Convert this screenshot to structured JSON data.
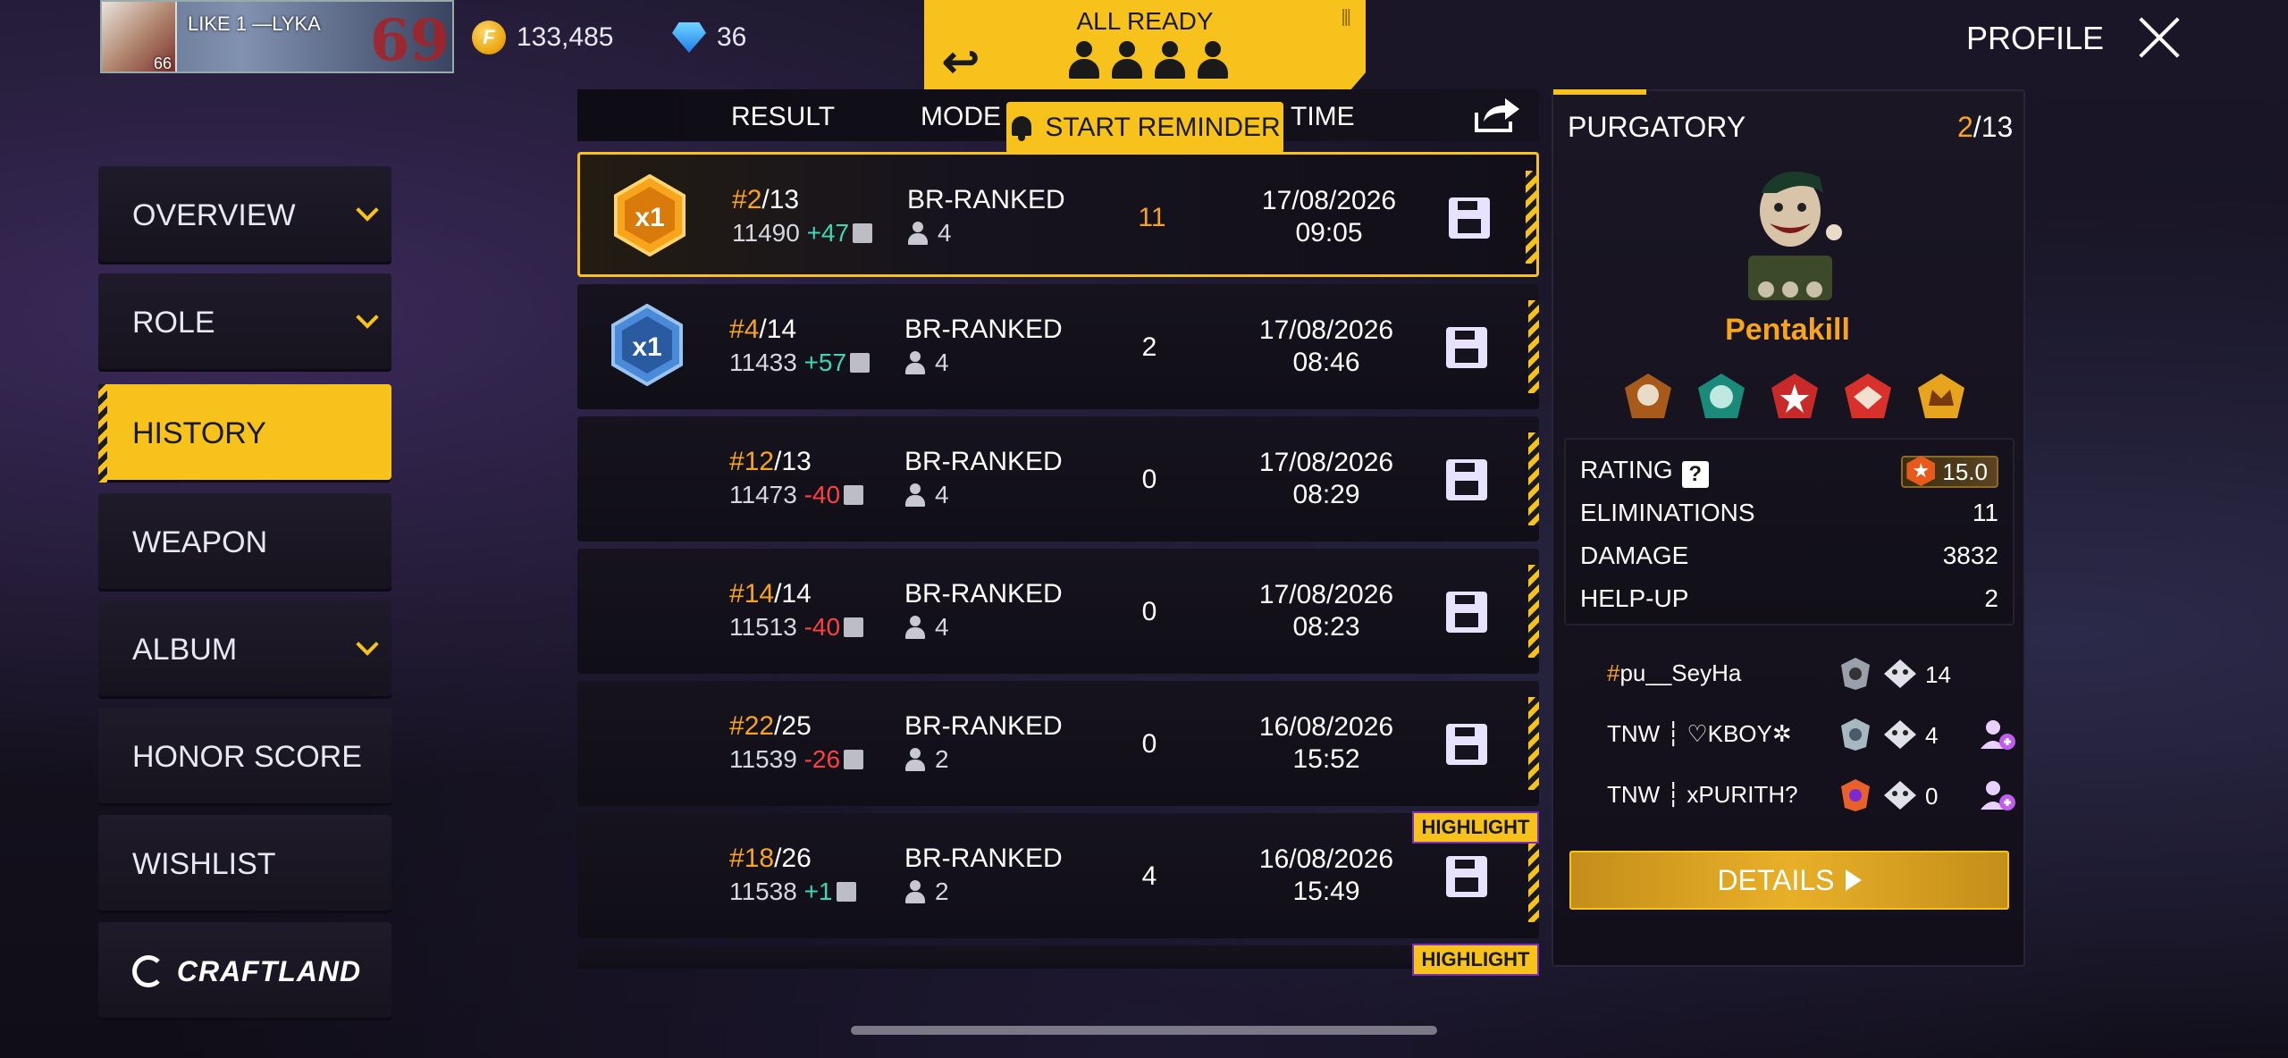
{
  "player": {
    "like_label": "LIKE",
    "like_count": "1",
    "name": "—LYKA",
    "level": "66",
    "badge_number": "69"
  },
  "currency": {
    "gold": "133,485",
    "diamonds": "36"
  },
  "lobby": {
    "status": "ALL READY",
    "reminder_label": "START REMINDER"
  },
  "header": {
    "profile_label": "PROFILE"
  },
  "sidebar": {
    "items": [
      {
        "label": "OVERVIEW",
        "expandable": true
      },
      {
        "label": "ROLE",
        "expandable": true
      },
      {
        "label": "HISTORY",
        "expandable": false,
        "active": true
      },
      {
        "label": "WEAPON",
        "expandable": false
      },
      {
        "label": "ALBUM",
        "expandable": true
      },
      {
        "label": "HONOR SCORE",
        "expandable": false
      },
      {
        "label": "WISHLIST",
        "expandable": false
      },
      {
        "label": "CRAFTLAND",
        "expandable": false
      }
    ]
  },
  "history": {
    "columns": [
      "RESULT",
      "MODE",
      "TIME"
    ],
    "rows": [
      {
        "rank": "2",
        "total": "13",
        "score": "11490",
        "delta": "+47",
        "mode": "BR-RANKED",
        "team": "4",
        "elims": "11",
        "date": "17/08/2026",
        "time": "09:05",
        "medal": "x1",
        "medal_color": "#f8a41c"
      },
      {
        "rank": "4",
        "total": "14",
        "score": "11433",
        "delta": "+57",
        "mode": "BR-RANKED",
        "team": "4",
        "elims": "2",
        "date": "17/08/2026",
        "time": "08:46",
        "medal": "x1",
        "medal_color": "#4a8ad8"
      },
      {
        "rank": "12",
        "total": "13",
        "score": "11473",
        "delta": "-40",
        "mode": "BR-RANKED",
        "team": "4",
        "elims": "0",
        "date": "17/08/2026",
        "time": "08:29"
      },
      {
        "rank": "14",
        "total": "14",
        "score": "11513",
        "delta": "-40",
        "mode": "BR-RANKED",
        "team": "4",
        "elims": "0",
        "date": "17/08/2026",
        "time": "08:23"
      },
      {
        "rank": "22",
        "total": "25",
        "score": "11539",
        "delta": "-26",
        "mode": "BR-RANKED",
        "team": "2",
        "elims": "0",
        "date": "16/08/2026",
        "time": "15:52"
      },
      {
        "rank": "18",
        "total": "26",
        "score": "11538",
        "delta": "+1",
        "mode": "BR-RANKED",
        "team": "2",
        "elims": "4",
        "date": "16/08/2026",
        "time": "15:49"
      }
    ],
    "highlight_label": "HIGHLIGHT"
  },
  "detail": {
    "map": "PURGATORY",
    "rank": "2",
    "total": "13",
    "character_title": "Pentakill",
    "stats": [
      {
        "label": "RATING",
        "value": "15.0"
      },
      {
        "label": "ELIMINATIONS",
        "value": "11"
      },
      {
        "label": "DAMAGE",
        "value": "3832"
      },
      {
        "label": "HELP-UP",
        "value": "2"
      }
    ],
    "team": [
      {
        "prefix": "#",
        "name": "pu__SeyHa",
        "kills": "14"
      },
      {
        "prefix": "TNW ┆ ",
        "name": "♡KBOY✲",
        "kills": "4"
      },
      {
        "prefix": "TNW ┆ ",
        "name": "xPURITH?",
        "kills": "0"
      }
    ],
    "details_label": "DETAILS"
  },
  "colors": {
    "accent": "#f8c21c",
    "orange": "#f8a41c",
    "positive": "#3fd6b4",
    "negative": "#ff4040"
  }
}
